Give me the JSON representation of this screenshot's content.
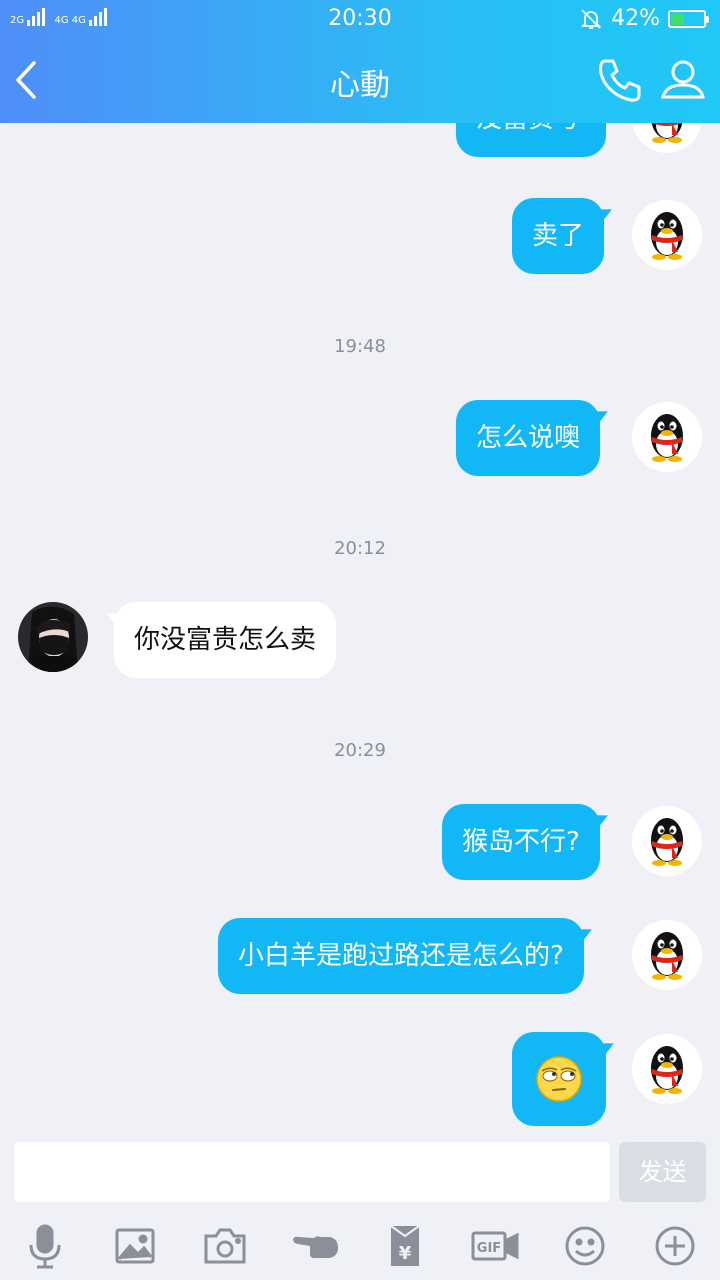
{
  "status_bar": {
    "network_left": "2G",
    "network_right": "4G 4G",
    "time": "20:30",
    "battery_percent": "42%",
    "battery_level": 0.42
  },
  "header": {
    "title": "心動"
  },
  "messages": {
    "m0": "没富贵号",
    "m1": "卖了",
    "t1": "19:48",
    "m2": "怎么说噢",
    "t2": "20:12",
    "m3": "你没富贵怎么卖",
    "t3": "20:29",
    "m4": "猴岛不行?",
    "m5": "小白羊是跑过路还是怎么的?",
    "m6_icon": "rolling-eyes-emoji-icon"
  },
  "input": {
    "placeholder": "",
    "send_label": "发送"
  },
  "toolbar": {
    "icons": [
      "microphone-icon",
      "image-icon",
      "camera-icon",
      "poke-icon",
      "red-packet-icon",
      "gif-icon",
      "emoji-icon",
      "plus-icon"
    ]
  },
  "colors": {
    "accent": "#12b7f5",
    "header_start": "#4f8ef7",
    "header_end": "#1fc8f7",
    "background": "#eff1f6",
    "icon_gray": "#8a8f99"
  }
}
